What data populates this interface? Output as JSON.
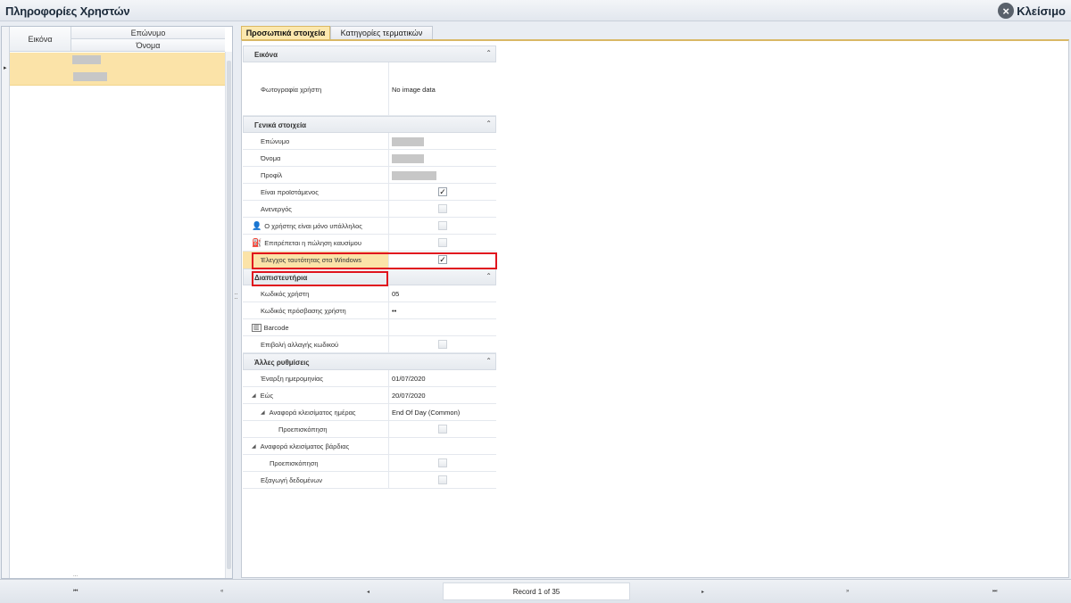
{
  "window": {
    "title": "Πληροφορίες Χρηστών",
    "close_label": "Κλείσιμο",
    "close_icon": "×"
  },
  "grid": {
    "col_image": "Εικόνα",
    "col_surname": "Επώνυμο",
    "col_name": "Όνομα",
    "row_indicator": "▸",
    "trailing_text": "..."
  },
  "tabs": {
    "personal": "Προσωπικά στοιχεία",
    "categories": "Κατηγορίες τερματικών"
  },
  "sections": {
    "image": {
      "title": "Εικόνα",
      "collapse_icon": "⌃",
      "photo_label": "Φωτογραφία χρήστη",
      "photo_value": "No image data"
    },
    "general": {
      "title": "Γενικά στοιχεία",
      "collapse_icon": "⌃",
      "surname": "Επώνυμο",
      "name": "Όνομα",
      "profile": "Προφίλ",
      "is_manager": "Είναι προϊστάμενος",
      "inactive": "Ανενεργός",
      "employee_only": "Ο χρήστης είναι μόνο υπάλληλος",
      "fuel_sale": "Επιτρέπεται η πώληση καυσίμου",
      "windows_auth": "Έλεγχος ταυτότητας στα Windows"
    },
    "credentials": {
      "title": "Διαπιστευτήρια",
      "collapse_icon": "⌃",
      "user_code": "Κωδικός χρήστη",
      "user_code_value": "05",
      "password": "Κωδικός πρόσβασης χρήστη",
      "password_value": "••",
      "barcode": "Barcode",
      "force_change": "Επιβολή αλλαγής κωδικού"
    },
    "other": {
      "title": "Άλλες ρυθμίσεις",
      "collapse_icon": "⌃",
      "start_date": "Έναρξη ημερομηνίας",
      "start_date_value": "01/07/2020",
      "until": "Εώς",
      "until_value": "20/07/2020",
      "day_close": "Αναφορά κλεισίματος ημέρας",
      "day_close_value": "End Of Day (Common)",
      "preview1": "Προεπισκόπηση",
      "shift_close": "Αναφορά κλεισίματος βάρδιας",
      "preview2": "Προεπισκόπηση",
      "export": "Εξαγωγή δεδομένων"
    }
  },
  "checkboxes": {
    "is_manager": true,
    "inactive": false,
    "employee_only": false,
    "fuel_sale": false,
    "windows_auth": true,
    "force_change": false,
    "preview1": false,
    "preview2": false,
    "export": false
  },
  "navigator": {
    "first": "⏮",
    "prev_page": "«",
    "prev": "◂",
    "record": "Record 1 of 35",
    "next": "▸",
    "next_page": "»",
    "last": "⏭"
  },
  "colors": {
    "highlight": "#fbe3a8",
    "annotation_red": "#e0141e"
  }
}
